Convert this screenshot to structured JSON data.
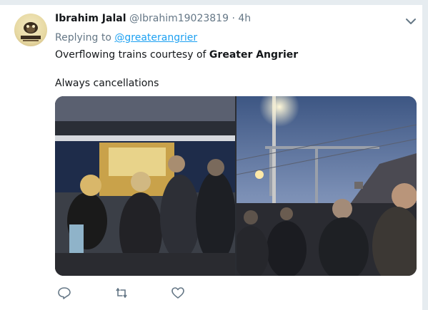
{
  "tweet": {
    "author_name": "Ibrahim Jalal",
    "handle": "@Ibrahim19023819",
    "separator": "·",
    "time": "4h",
    "replying_to_prefix": "Replying to",
    "replying_to_handle": "@greaterangrier",
    "text_line1_prefix": "Overflowing trains courtesy of",
    "text_line1_bold": "Greater Angrier",
    "text_line2": "Always cancellations"
  },
  "icons": {
    "menu": "chevron-down-icon",
    "reply": "reply-icon",
    "retweet": "retweet-icon",
    "like": "heart-icon"
  },
  "colors": {
    "link": "#1da1f2",
    "muted": "#657786",
    "text": "#14171a",
    "background": "#e6ecf0"
  }
}
